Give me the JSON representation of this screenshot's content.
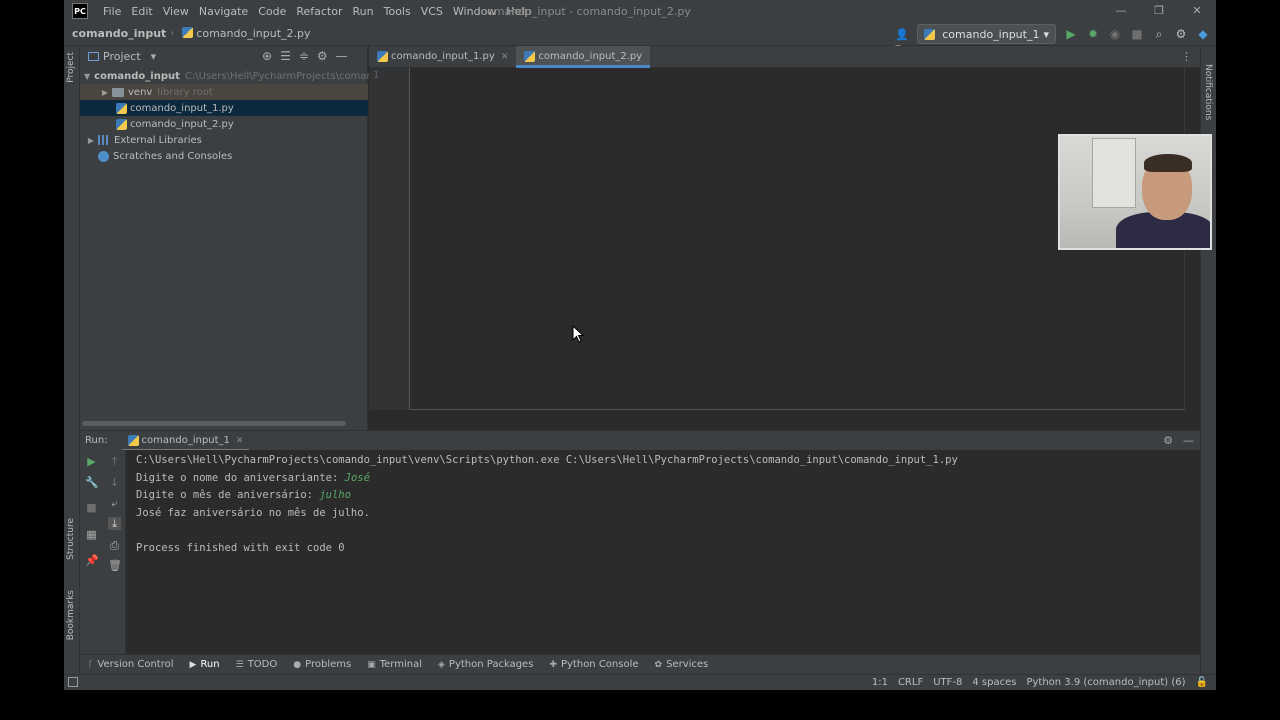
{
  "window": {
    "logo": "PC",
    "title": "comando_input - comando_input_2.py",
    "menu": [
      "File",
      "Edit",
      "View",
      "Navigate",
      "Code",
      "Refactor",
      "Run",
      "Tools",
      "VCS",
      "Window",
      "Help"
    ],
    "controls": [
      "—",
      "❐",
      "✕"
    ]
  },
  "navbar": {
    "project": "comando_input",
    "file": "comando_input_2.py",
    "run_config": "comando_input_1"
  },
  "project_panel": {
    "title": "Project",
    "root_label": "comando_input",
    "root_path": "C:\\Users\\Hell\\PycharmProjects\\comando_i",
    "root_badge": "1",
    "venv_label": "venv",
    "venv_note": "library root",
    "file1": "comando_input_1.py",
    "file2": "comando_input_2.py",
    "external": "External Libraries",
    "scratches": "Scratches and Consoles"
  },
  "side_labels": {
    "project": "Project",
    "structure": "Structure",
    "bookmarks": "Bookmarks",
    "notifications": "Notifications"
  },
  "editor": {
    "tabs": [
      "comando_input_1.py",
      "comando_input_2.py"
    ],
    "line_number": "1"
  },
  "run_panel": {
    "label": "Run:",
    "tab": "comando_input_1",
    "console": {
      "cmd": "C:\\Users\\Hell\\PycharmProjects\\comando_input\\venv\\Scripts\\python.exe C:\\Users\\Hell\\PycharmProjects\\comando_input\\comando_input_1.py",
      "prompt1": "Digite o nome do aniversariante: ",
      "input1": "José",
      "prompt2": "Digite o mês de aniversário: ",
      "input2": "julho",
      "result": "José faz aniversário no mês de julho.",
      "exit": "Process finished with exit code 0"
    }
  },
  "tool_windows": [
    "Version Control",
    "Run",
    "TODO",
    "Problems",
    "Terminal",
    "Python Packages",
    "Python Console",
    "Services"
  ],
  "status_bar": {
    "position": "1:1",
    "line_sep": "CRLF",
    "encoding": "UTF-8",
    "indent": "4 spaces",
    "interpreter": "Python 3.9 (comando_input) (6)"
  }
}
